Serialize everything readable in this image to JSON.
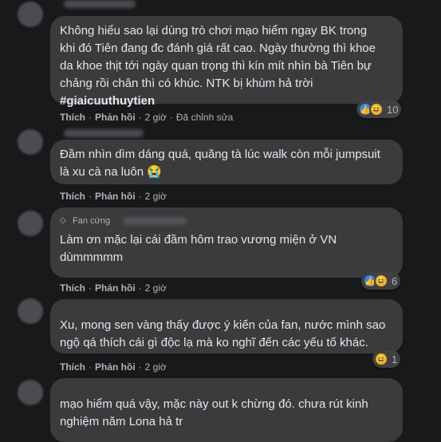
{
  "comments": [
    {
      "text": "Không hiểu sao lại dùng trò chơi mạo hiểm ngay BK trong\nkhi đó Tiên đang đc đánh giá rất cao. Ngày thường thì khoe\nda khoe thịt tới ngày quan trọng thì kín mít nhìn bà Tiên bự\nchảng rồi chân thì có khúc. NTK bị khùm hả trời",
      "hashtag": "#giaicuuthuytien",
      "like": "Thích",
      "reply": "Phản hồi",
      "time": "2 giờ",
      "edited": "Đã chỉnh sửa",
      "reaction_count": "10",
      "reactions": [
        "like-icon",
        "haha-icon"
      ]
    },
    {
      "text": "Đầm nhìn dìm dáng quá, quăng tà lúc walk còn mỗi jumpsuit\nlà xu cà na luôn 😭",
      "like": "Thích",
      "reply": "Phản hồi",
      "time": "2 giờ"
    },
    {
      "badge": "Fan cứng",
      "text": "Làm ơn mặc lại cái đầm hôm trao vương miện ở VN\ndùmmmmm",
      "like": "Thích",
      "reply": "Phản hồi",
      "time": "2 giờ",
      "reaction_count": "6",
      "reactions": [
        "like-icon",
        "haha-icon"
      ]
    },
    {
      "text": "Xu, mong sen vàng thấy được ý kiến của fan, nước mình sao\nngộ qá thích cái gì độc lạ mà ko nghĩ đến các yếu tố khác.",
      "like": "Thích",
      "reply": "Phản hồi",
      "time": "2 giờ",
      "reaction_count": "1",
      "reactions": [
        "haha-icon"
      ]
    },
    {
      "text": "mạo hiểm quá vậy, mặc này out k chừng đó. chưa rút kinh\nnghiệm năm Lona hả tr"
    }
  ],
  "colors": {
    "background": "#18191a",
    "bubble": "#3a3b3c",
    "text": "#e4e6eb",
    "secondary": "#b0b3b8",
    "like_blue": "#2d88ff",
    "haha_yellow": "#f7b125"
  }
}
